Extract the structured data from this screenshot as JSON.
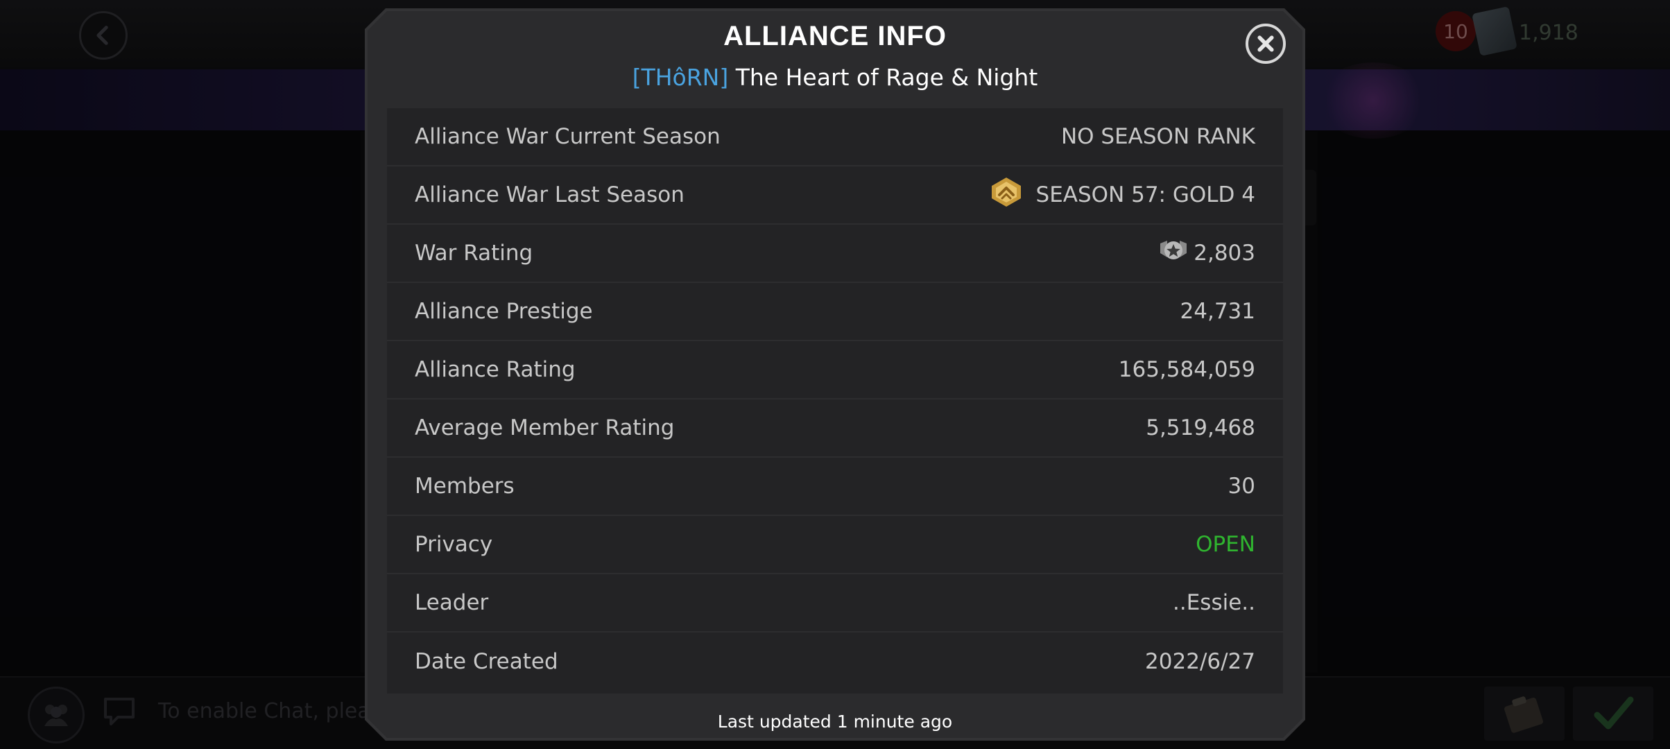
{
  "background": {
    "currency_badge": "10",
    "currency_amount": "1,918",
    "chat_hint": "To enable Chat, pleas"
  },
  "modal": {
    "title": "ALLIANCE INFO",
    "alliance_tag": "[THôRN]",
    "alliance_name": "The Heart of Rage & Night",
    "rows": [
      {
        "label": "Alliance War Current Season",
        "value": "NO SEASON RANK"
      },
      {
        "label": "Alliance War Last Season",
        "value": "SEASON 57: GOLD 4",
        "icon": "gold-season-badge-icon"
      },
      {
        "label": "War Rating",
        "value": "2,803",
        "icon": "war-rating-icon"
      },
      {
        "label": "Alliance Prestige",
        "value": "24,731"
      },
      {
        "label": "Alliance Rating",
        "value": "165,584,059"
      },
      {
        "label": "Average Member Rating",
        "value": "5,519,468"
      },
      {
        "label": "Members",
        "value": "30"
      },
      {
        "label": "Privacy",
        "value": "OPEN",
        "value_color": "#2fb52f"
      },
      {
        "label": "Leader",
        "value": "..Essie.."
      },
      {
        "label": "Date Created",
        "value": "2022/6/27"
      }
    ],
    "footer": "Last updated 1 minute ago"
  }
}
